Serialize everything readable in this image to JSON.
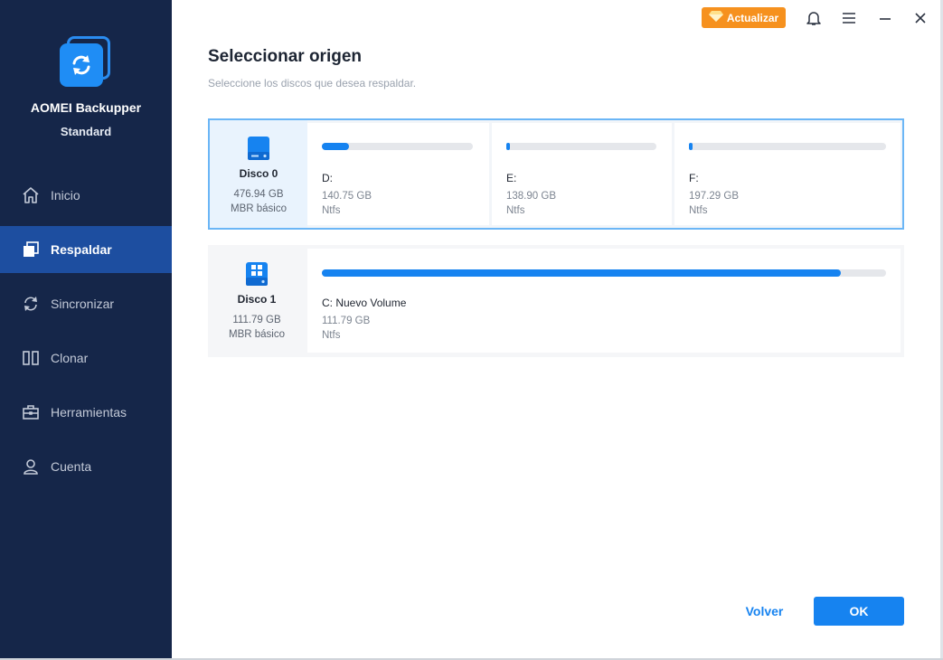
{
  "app": {
    "name": "AOMEI Backupper",
    "edition": "Standard"
  },
  "sidebar": {
    "items": [
      {
        "label": "Inicio",
        "icon": "home-icon",
        "active": false
      },
      {
        "label": "Respaldar",
        "icon": "backup-icon",
        "active": true
      },
      {
        "label": "Sincronizar",
        "icon": "sync-icon",
        "active": false
      },
      {
        "label": "Clonar",
        "icon": "clone-icon",
        "active": false
      },
      {
        "label": "Herramientas",
        "icon": "toolbox-icon",
        "active": false
      },
      {
        "label": "Cuenta",
        "icon": "user-icon",
        "active": false
      }
    ]
  },
  "topbar": {
    "upgrade_label": "Actualizar"
  },
  "main": {
    "title": "Seleccionar origen",
    "subtitle": "Seleccione los discos que desea respaldar."
  },
  "disks": [
    {
      "name": "Disco 0",
      "size": "476.94 GB",
      "type": "MBR básico",
      "selected": true,
      "partitions": [
        {
          "label": "D:",
          "size": "140.75 GB",
          "fs": "Ntfs",
          "used_percent": 18
        },
        {
          "label": "E:",
          "size": "138.90 GB",
          "fs": "Ntfs",
          "used_percent": 2
        },
        {
          "label": "F:",
          "size": "197.29 GB",
          "fs": "Ntfs",
          "used_percent": 2
        }
      ]
    },
    {
      "name": "Disco 1",
      "size": "111.79 GB",
      "type": "MBR básico",
      "selected": false,
      "partitions": [
        {
          "label": "C: Nuevo Volume",
          "size": "111.79 GB",
          "fs": "Ntfs",
          "used_percent": 92
        }
      ]
    }
  ],
  "footer": {
    "back_label": "Volver",
    "ok_label": "OK"
  },
  "colors": {
    "sidebar": "#152649",
    "active": "#1d4ea0",
    "accent": "#1683f0",
    "upgrade": "#f6911e"
  }
}
